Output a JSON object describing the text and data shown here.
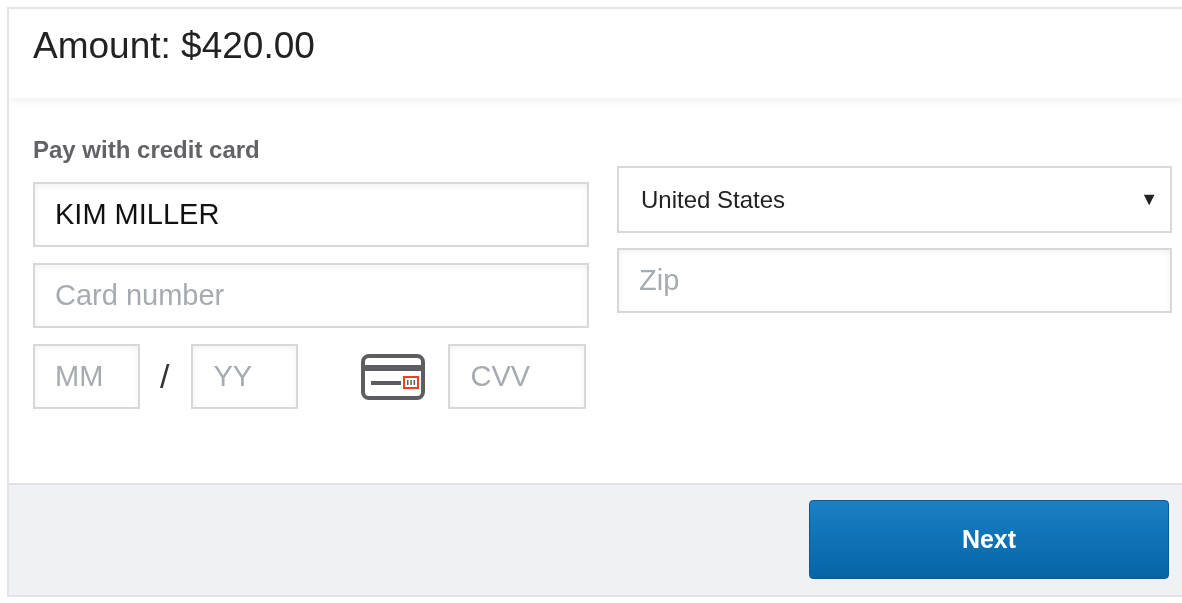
{
  "header": {
    "amount": "Amount: $420.00"
  },
  "form": {
    "title": "Pay with credit card",
    "name": {
      "value": "KIM MILLER"
    },
    "card_number": {
      "placeholder": "Card number"
    },
    "month": {
      "placeholder": "MM"
    },
    "separator": "/",
    "year": {
      "placeholder": "YY"
    },
    "cvv": {
      "placeholder": "CVV"
    },
    "country": {
      "value": "United States",
      "caret": "▼"
    },
    "zip": {
      "placeholder": "Zip"
    }
  },
  "footer": {
    "button": "Next"
  }
}
